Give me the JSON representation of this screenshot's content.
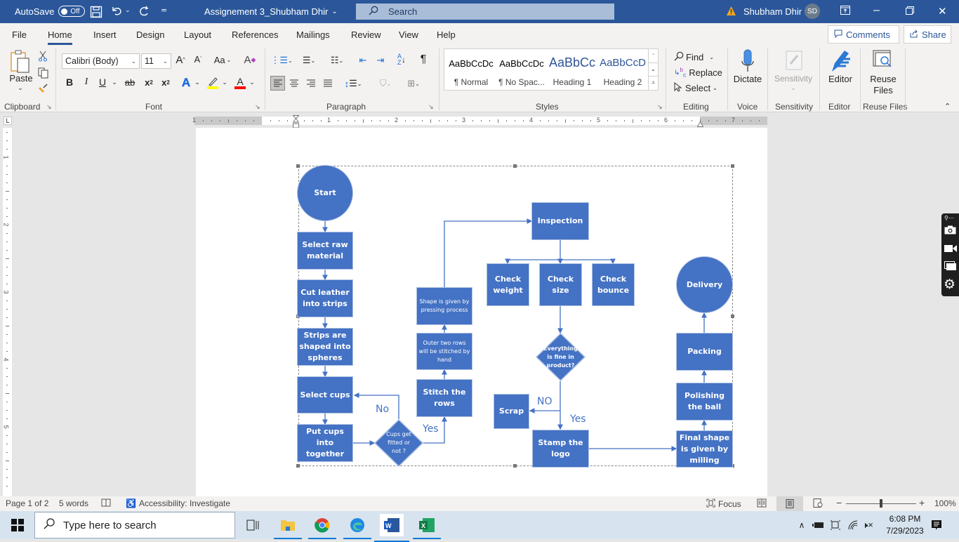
{
  "titlebar": {
    "autosave_label": "AutoSave",
    "autosave_state": "Off",
    "doc_title": "Assignement 3_Shubham Dhir",
    "search_placeholder": "Search",
    "user_name": "Shubham Dhir",
    "user_initials": "SD"
  },
  "menu": {
    "tabs": [
      "File",
      "Home",
      "Insert",
      "Design",
      "Layout",
      "References",
      "Mailings",
      "Review",
      "View",
      "Help"
    ],
    "active_tab": "Home",
    "comments_label": "Comments",
    "share_label": "Share"
  },
  "ribbon": {
    "clipboard": {
      "paste_label": "Paste",
      "group_label": "Clipboard"
    },
    "font": {
      "font_name": "Calibri (Body)",
      "font_size": "11",
      "group_label": "Font",
      "highlight_color": "#ffff00",
      "font_color": "#ff0000"
    },
    "paragraph": {
      "group_label": "Paragraph"
    },
    "styles": {
      "group_label": "Styles",
      "items": [
        {
          "sample": "AaBbCcDc",
          "name": "¶ Normal"
        },
        {
          "sample": "AaBbCcDc",
          "name": "¶ No Spac..."
        },
        {
          "sample": "AaBbCc",
          "name": "Heading 1"
        },
        {
          "sample": "AaBbCcD",
          "name": "Heading 2"
        }
      ]
    },
    "editing": {
      "find": "Find",
      "replace": "Replace",
      "select": "Select",
      "group_label": "Editing"
    },
    "voice": {
      "dictate": "Dictate",
      "group_label": "Voice"
    },
    "sensitivity": {
      "label": "Sensitivity",
      "group_label": "Sensitivity"
    },
    "editor": {
      "label": "Editor",
      "group_label": "Editor"
    },
    "reuse": {
      "label1": "Reuse",
      "label2": "Files",
      "group_label": "Reuse Files"
    }
  },
  "ruler": {
    "h_marks": [
      "1",
      "1",
      "2",
      "3",
      "4",
      "5",
      "6",
      "7"
    ],
    "v_marks": [
      "1",
      "2",
      "3",
      "4",
      "5"
    ]
  },
  "flowchart": {
    "color": "#4472c4",
    "nodes": {
      "start": "Start",
      "raw": "Select raw material",
      "cut": "Cut leather into strips",
      "strips": "Strips are shaped into spheres",
      "cups": "Select cups",
      "put": "Put cups into together",
      "decision1": "Cups get fitted or not ?",
      "stitch": "Stitch the rows",
      "outer": "Outer two rows will be stitched by hand",
      "shape": "Shape is given by pressing process",
      "inspection": "Inspection",
      "weight": "Check weight",
      "size": "Check size",
      "bounce": "Check bounce",
      "decision2": "Everything is fine in product?",
      "scrap": "Scrap",
      "stamp": "Stamp the logo",
      "final": "Final shape is given by milling",
      "polish": "Polishing the ball",
      "packing": "Packing",
      "delivery": "Delivery"
    },
    "labels": {
      "no1": "No",
      "yes1": "Yes",
      "no2": "NO",
      "yes2": "Yes"
    }
  },
  "status": {
    "page": "Page 1 of 2",
    "words": "5 words",
    "accessibility": "Accessibility: Investigate",
    "focus": "Focus",
    "zoom": "100%",
    "zoom_value": 100
  },
  "taskbar": {
    "search_placeholder": "Type here to search",
    "time": "6:08 PM",
    "date": "7/29/2023"
  }
}
